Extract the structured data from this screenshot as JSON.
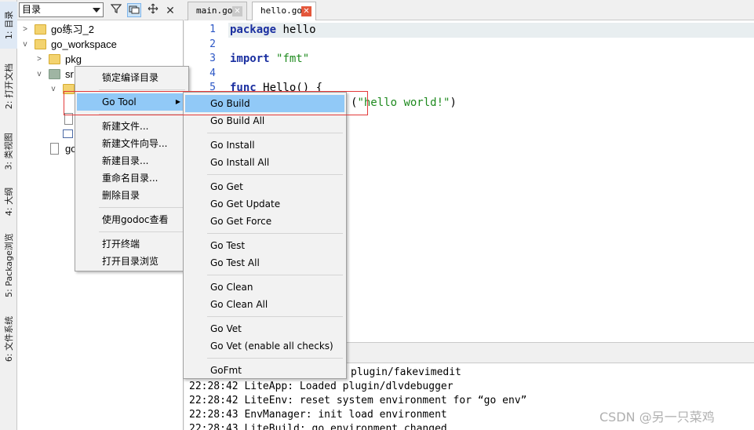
{
  "side_tabs": [
    {
      "label": "1: 目录"
    },
    {
      "label": "2: 打开文档"
    },
    {
      "label": "3: 类视图"
    },
    {
      "label": "4: 大纲"
    },
    {
      "label": "5: Package浏览"
    },
    {
      "label": "6: 文件系统"
    }
  ],
  "left_panel": {
    "selector_value": "目录",
    "tree": [
      {
        "label": "go练习_2"
      },
      {
        "label": "go_workspace"
      },
      {
        "label": "pkg"
      },
      {
        "label": "sr"
      },
      {
        "label": "go"
      }
    ]
  },
  "editor_tabs": [
    {
      "label": "main.go",
      "close": "✕"
    },
    {
      "label": "hello.go",
      "close": "✕"
    }
  ],
  "code_lines": [
    {
      "num": "1",
      "parts": [
        {
          "t": "package",
          "c": "kw"
        },
        {
          "t": " hello",
          "c": "plain"
        }
      ]
    },
    {
      "num": "2",
      "parts": []
    },
    {
      "num": "3",
      "parts": [
        {
          "t": "import",
          "c": "kw"
        },
        {
          "t": " ",
          "c": "plain"
        },
        {
          "t": "\"fmt\"",
          "c": "str"
        }
      ]
    },
    {
      "num": "4",
      "parts": []
    },
    {
      "num": "5",
      "parts": [
        {
          "t": "func",
          "c": "kw"
        },
        {
          "t": " Hello() {",
          "c": "plain"
        }
      ]
    }
  ],
  "code_visible_tail": {
    "prefix": "(",
    "string": "\"hello world!\"",
    "suffix": ")"
  },
  "output_lines": [
    "plugin/fakevimedit",
    "22:28:42 LiteApp: Loaded plugin/dlvdebugger",
    "22:28:42 LiteEnv: reset system environment for “go env”",
    "22:28:43 EnvManager: init load environment",
    "22:28:43 LiteBuild: go environment changed"
  ],
  "context_menu": {
    "groups": [
      [
        "锁定编译目录"
      ],
      [
        "Go Tool"
      ],
      [
        "新建文件...",
        "新建文件向导...",
        "新建目录...",
        "重命名目录...",
        "删除目录"
      ],
      [
        "使用godoc查看"
      ],
      [
        "打开终端",
        "打开目录浏览"
      ]
    ],
    "submenu_arrow": "▶"
  },
  "go_tool_submenu": {
    "groups": [
      [
        "Go Build",
        "Go Build All"
      ],
      [
        "Go Install",
        "Go Install All"
      ],
      [
        "Go Get",
        "Go Get Update",
        "Go Get Force"
      ],
      [
        "Go Test",
        "Go Test All"
      ],
      [
        "Go Clean",
        "Go Clean All"
      ],
      [
        "Go Vet",
        "Go Vet (enable all checks)"
      ],
      [
        "GoFmt"
      ]
    ],
    "highlighted": "Go Build"
  },
  "watermark": "CSDN @另一只菜鸡",
  "colors": {
    "highlight": "#91c9f7",
    "annotation_red": "#e33a3a",
    "keyword": "#1a2fa0",
    "string": "#1e8a1e",
    "active_close": "#e4573b"
  }
}
